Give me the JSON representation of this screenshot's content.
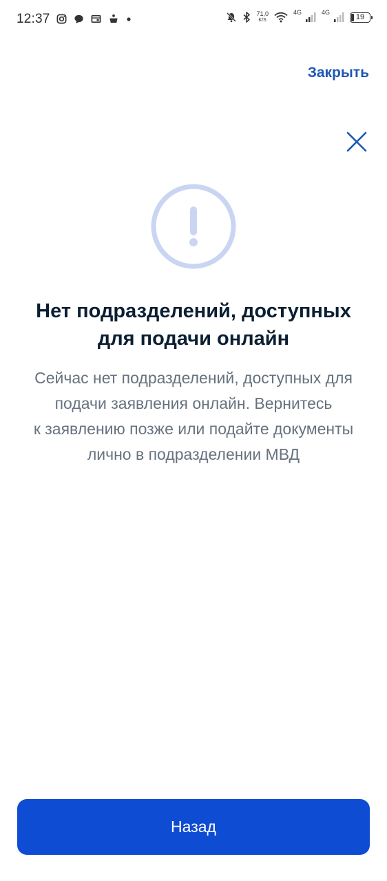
{
  "status_bar": {
    "time": "12:37",
    "net_speed_value": "71,0",
    "net_speed_unit": "K/S",
    "network_1": "4G",
    "network_2": "4G",
    "battery_level": "19",
    "left_icons": [
      "instagram-icon",
      "chat-icon",
      "wallet-icon",
      "cart-icon",
      "dot-icon"
    ],
    "right_icons": [
      "mute-icon",
      "bluetooth-icon",
      "wifi-icon",
      "signal-icon",
      "signal-icon",
      "battery-icon"
    ]
  },
  "header": {
    "close_link_label": "Закрыть"
  },
  "message": {
    "icon": "alert-circle-icon",
    "title_line1": "Нет подразделений, доступных",
    "title_line2": "для подачи онлайн",
    "desc_line1": "Сейчас нет подразделений, доступных для",
    "desc_line2": "подачи заявления онлайн. Вернитесь",
    "desc_line3": "к заявлению позже или подайте документы",
    "desc_line4": "лично в подразделении МВД"
  },
  "footer": {
    "back_button_label": "Назад"
  },
  "colors": {
    "accent": "#0d4cd3",
    "link": "#1f58b5",
    "icon_circle": "#c9d5f3",
    "title": "#0b1f33",
    "body_text": "#66727f"
  }
}
